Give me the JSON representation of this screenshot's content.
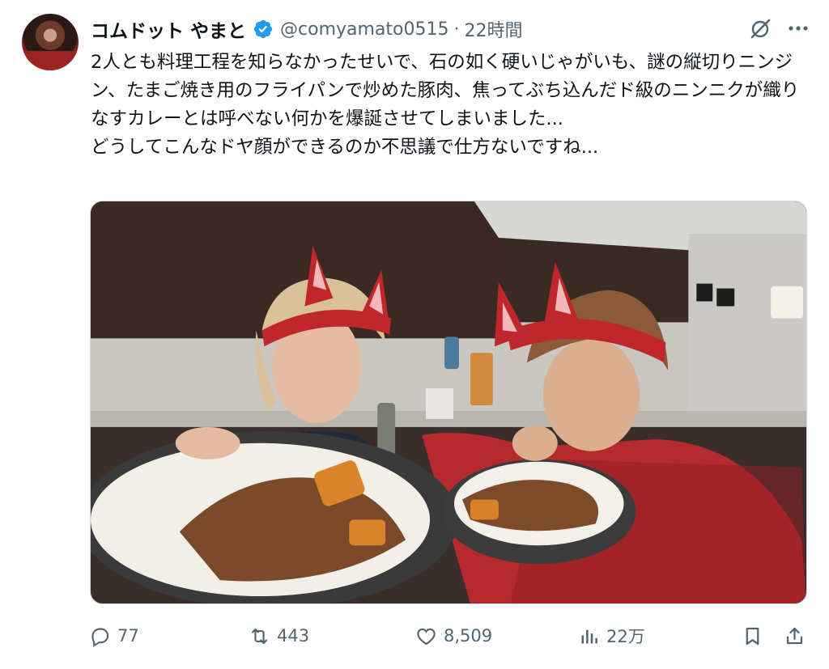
{
  "tweet": {
    "display_name": "コムドット やまと",
    "verified_icon": "verified-badge-icon",
    "handle": "@comyamato0515",
    "separator": "·",
    "time": "22時間",
    "text": "2人とも料理工程を知らなかったせいで、石の如く硬いじゃがいも、謎の縦切りニンジン、たまご焼き用のフライパンで炒めた豚肉、焦ってぶち込んだド級のニンニクが織りなすカレーとは呼べない何かを爆誕させてしまいました...\nどうしてこんなドヤ顔ができるのか不思議で仕方ないですね..."
  },
  "top_actions": [
    {
      "icon": "grok-icon"
    },
    {
      "icon": "more-icon"
    }
  ],
  "actions": {
    "reply": {
      "icon": "reply-icon",
      "count": "77"
    },
    "retweet": {
      "icon": "retweet-icon",
      "count": "443"
    },
    "like": {
      "icon": "heart-icon",
      "count": "8,509"
    },
    "views": {
      "icon": "views-icon",
      "count": "22万"
    },
    "bookmark": {
      "icon": "bookmark-icon"
    },
    "share": {
      "icon": "share-icon"
    }
  },
  "colors": {
    "text_primary": "#0f1419",
    "text_secondary": "#536471",
    "verified_blue": "#1d9bf0",
    "border": "#cfd9de"
  }
}
